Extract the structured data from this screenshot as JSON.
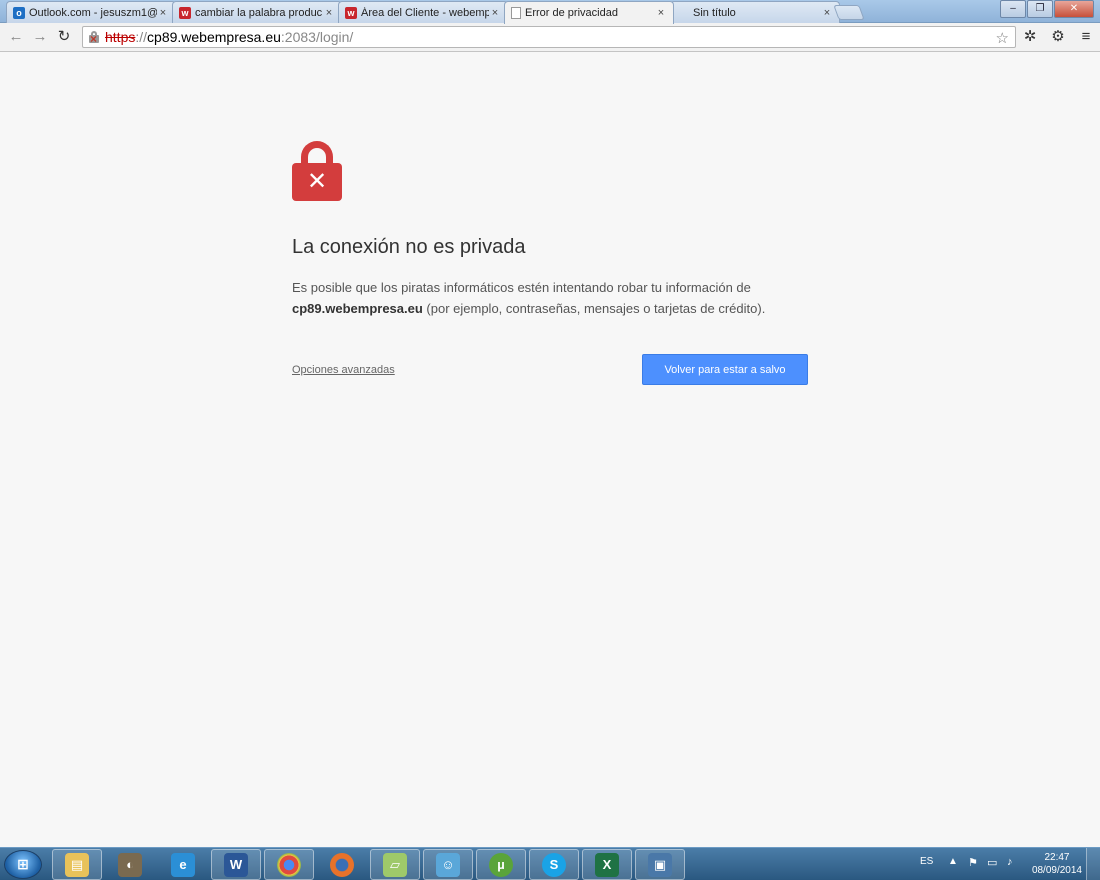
{
  "browser": {
    "tabs": [
      {
        "label": "Outlook.com - jesuszm1@",
        "favicon": "outlook-icon",
        "active": false
      },
      {
        "label": "cambiar la palabra produc",
        "favicon": "webempresa-icon",
        "active": false
      },
      {
        "label": "Área del Cliente - webemp",
        "favicon": "webempresa-icon",
        "active": false
      },
      {
        "label": "Error de privacidad",
        "favicon": "page-icon",
        "active": true
      },
      {
        "label": "Sin título",
        "favicon": "none",
        "active": false
      }
    ],
    "close_glyph": "×",
    "window_controls": {
      "minimize": "–",
      "maximize": "❐",
      "close": "✕"
    },
    "url": {
      "scheme": "https",
      "separator": "://",
      "host": "cp89.webempresa.eu",
      "path": ":2083/login/"
    }
  },
  "page": {
    "heading": "La conexión no es privada",
    "description_before": "Es posible que los piratas informáticos estén intentando robar tu información de",
    "description_host": "cp89.webempresa.eu",
    "description_after": "(por ejemplo, contraseñas, mensajes o tarjetas de crédito).",
    "advanced_link": "Opciones avanzadas",
    "safe_button": "Volver para estar a salvo",
    "accent_color": "#4d90fe",
    "lock_color": "#d33d3d"
  },
  "taskbar": {
    "apps": [
      "explorer-icon",
      "gimp-icon",
      "ie-icon",
      "word-icon",
      "chrome-icon",
      "firefox-icon",
      "folder-icon",
      "messenger-icon",
      "utorrent-icon",
      "skype-icon",
      "excel-icon",
      "photo-viewer-icon"
    ],
    "language": "ES",
    "time": "22:47",
    "date": "08/09/2014"
  }
}
